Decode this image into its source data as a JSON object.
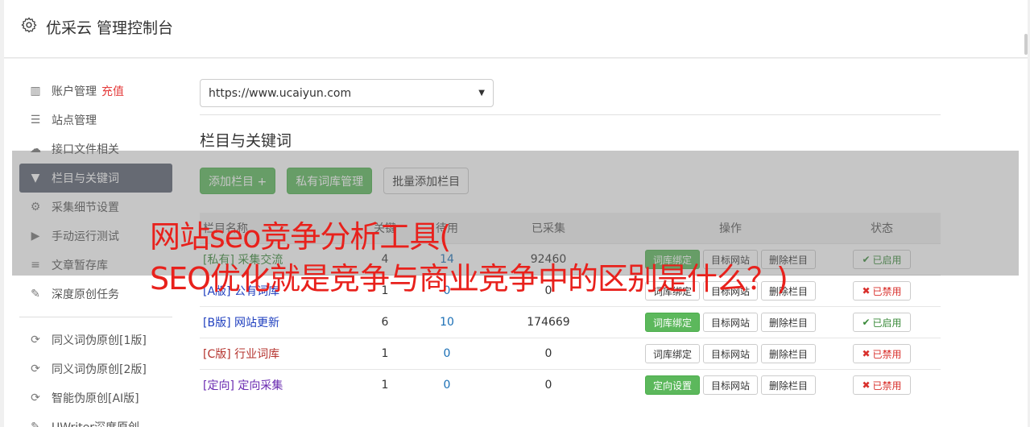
{
  "header": {
    "title": "优采云 管理控制台",
    "icon": "gear-icon"
  },
  "sidebar": {
    "items": [
      {
        "label": "账户管理",
        "extra": "充值",
        "icon": "bar-chart-icon",
        "glyph": "▥"
      },
      {
        "label": "站点管理",
        "icon": "server-icon",
        "glyph": "☰"
      },
      {
        "label": "接口文件相关",
        "icon": "cloud-upload-icon",
        "glyph": "☁"
      },
      {
        "label": "栏目与关键词",
        "icon": "filter-icon",
        "glyph": "▼",
        "active": true
      },
      {
        "label": "采集细节设置",
        "icon": "gears-icon",
        "glyph": "⚙"
      },
      {
        "label": "手动运行测试",
        "icon": "play-circle-icon",
        "glyph": "▶"
      },
      {
        "label": "文章暂存库",
        "icon": "database-icon",
        "glyph": "≡"
      },
      {
        "label": "深度原创任务",
        "icon": "edit-icon",
        "glyph": "✎"
      }
    ],
    "items2": [
      {
        "label": "同义词伪原创[1版]",
        "icon": "refresh-icon",
        "glyph": "⟳"
      },
      {
        "label": "同义词伪原创[2版]",
        "icon": "refresh-icon",
        "glyph": "⟳"
      },
      {
        "label": "智能伪原创[AI版]",
        "icon": "refresh-icon",
        "glyph": "⟳"
      },
      {
        "label": "UWriter深度原创",
        "icon": "edit-icon",
        "glyph": "✎"
      }
    ]
  },
  "content": {
    "site_select": "https://www.ucaiyun.com",
    "section_title": "栏目与关键词",
    "buttons": {
      "add": "添加栏目 +",
      "private_lib": "私有词库管理",
      "batch_add": "批量添加栏目"
    }
  },
  "table": {
    "headers": {
      "name": "栏目名称",
      "col2": "关键",
      "pending": "待用",
      "collected": "已采集",
      "ops": "操作",
      "status": "状态"
    },
    "rows": [
      {
        "tag": "[私有]",
        "name": "采集交流",
        "tag_color": "green",
        "kw": "4",
        "pending": "14",
        "collected": "92460",
        "bind": "词库绑定",
        "bind_green": true,
        "target": "目标网站",
        "del": "删除栏目",
        "status": "已启用",
        "on": true
      },
      {
        "tag": "[A版]",
        "name": "公有词库",
        "tag_color": "blue",
        "kw": "1",
        "pending": "0",
        "collected": "0",
        "bind": "词库绑定",
        "bind_green": false,
        "target": "目标网站",
        "del": "删除栏目",
        "status": "已禁用",
        "on": false
      },
      {
        "tag": "[B版]",
        "name": "网站更新",
        "tag_color": "blue",
        "kw": "6",
        "pending": "10",
        "collected": "174669",
        "bind": "词库绑定",
        "bind_green": true,
        "target": "目标网站",
        "del": "删除栏目",
        "status": "已启用",
        "on": true
      },
      {
        "tag": "[C版]",
        "name": "行业词库",
        "tag_color": "red",
        "kw": "1",
        "pending": "0",
        "collected": "0",
        "bind": "词库绑定",
        "bind_green": false,
        "target": "目标网站",
        "del": "删除栏目",
        "status": "已禁用",
        "on": false
      },
      {
        "tag": "[定向]",
        "name": "定向采集",
        "tag_color": "purple",
        "kw": "1",
        "pending": "0",
        "collected": "0",
        "bind": "定向设置",
        "bind_green": true,
        "target": "目标网站",
        "del": "删除栏目",
        "status": "已禁用",
        "on": false
      }
    ]
  },
  "overlay": {
    "line1": "网站seo竞争分析工具(",
    "line2": "SEO优化就是竞争与商业竞争中的区别是什么？)"
  }
}
